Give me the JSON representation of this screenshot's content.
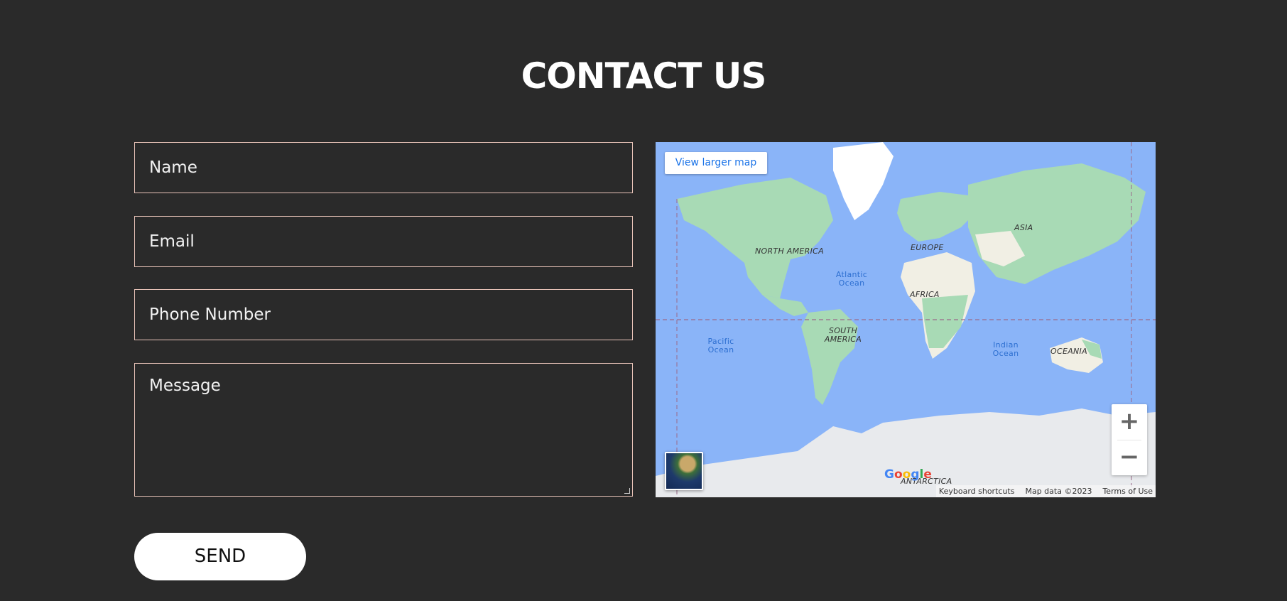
{
  "header": {
    "title": "CONTACT US"
  },
  "form": {
    "name_placeholder": "Name",
    "email_placeholder": "Email",
    "phone_placeholder": "Phone Number",
    "message_placeholder": "Message",
    "send_label": "SEND"
  },
  "map": {
    "view_larger_label": "View larger map",
    "labels": {
      "north_america": "NORTH AMERICA",
      "south_america": "SOUTH AMERICA",
      "europe": "EUROPE",
      "africa": "AFRICA",
      "asia": "ASIA",
      "oceania": "OCEANIA",
      "antarctica": "ANTARCTICA",
      "atlantic": "Atlantic Ocean",
      "pacific": "Pacific Ocean",
      "indian": "Indian Ocean"
    },
    "google_logo": [
      "G",
      "o",
      "o",
      "g",
      "l",
      "e"
    ],
    "footer": {
      "shortcuts": "Keyboard shortcuts",
      "map_data": "Map data ©2023",
      "terms": "Terms of Use"
    },
    "zoom_in_symbol": "+",
    "zoom_out_symbol": "−",
    "colors": {
      "water": "#8ab4f8",
      "land": "#a8dab5",
      "ice": "#e8eaed"
    }
  }
}
